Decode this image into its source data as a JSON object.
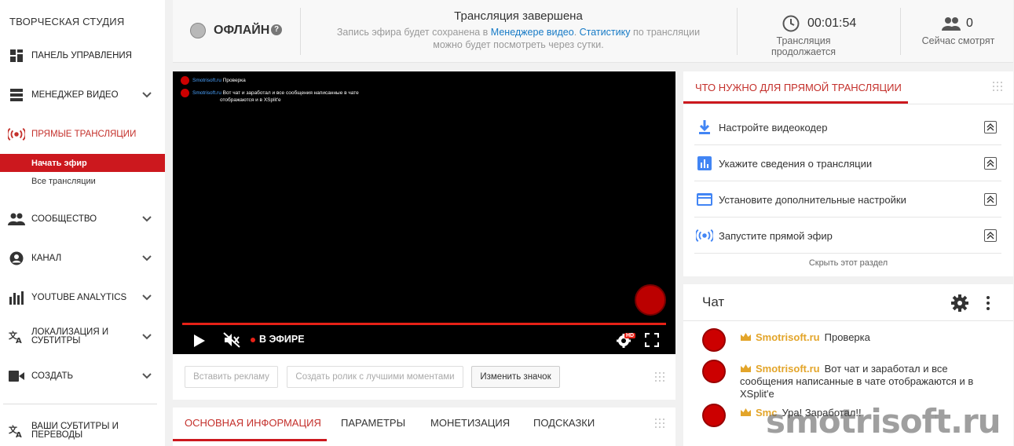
{
  "sidebar": {
    "title": "ТВОРЧЕСКАЯ СТУДИЯ",
    "items": [
      {
        "label": "ПАНЕЛЬ УПРАВЛЕНИЯ",
        "icon": "dashboard-icon"
      },
      {
        "label": "МЕНЕДЖЕР ВИДЕО",
        "icon": "video-manager-icon"
      },
      {
        "label": "ПРЯМЫЕ ТРАНСЛЯЦИИ",
        "icon": "live-icon"
      },
      {
        "label": "СООБЩЕСТВО",
        "icon": "community-icon"
      },
      {
        "label": "КАНАЛ",
        "icon": "channel-icon"
      },
      {
        "label": "YOUTUBE ANALYTICS",
        "icon": "analytics-icon"
      },
      {
        "label": "ЛОКАЛИЗАЦИЯ И\nСУБТИТРЫ",
        "label1": "ЛОКАЛИЗАЦИЯ И",
        "label2": "СУБТИТРЫ",
        "icon": "translate-icon"
      },
      {
        "label": "СОЗДАТЬ",
        "icon": "create-icon"
      },
      {
        "label1": "ВАШИ СУБТИТРЫ И",
        "label2": "ПЕРЕВОДЫ",
        "icon": "translate-icon"
      }
    ],
    "sub_items": [
      "Начать эфир",
      "Все трансляции"
    ]
  },
  "header": {
    "status": "ОФЛАЙН",
    "help": "?",
    "broadcast_title": "Трансляция завершена",
    "desc_part1": "Запись эфира будет сохранена в ",
    "desc_link1": "Менеджере видео",
    "desc_part2": ". ",
    "desc_link2": "Статистику",
    "desc_part3": " по трансляции",
    "desc_line2": "можно будет посмотреть через сутки.",
    "timer_value": "00:01:54",
    "timer_label": "Трансляция продолжается",
    "viewers_value": "0",
    "viewers_label": "Сейчас смотрят"
  },
  "player": {
    "overlay": [
      {
        "name": "Smotrisoft.ru",
        "text": "Проверка"
      },
      {
        "name": "Smotrisoft.ru",
        "text": "Вот чат и заработал и все сообщения написанные в чате",
        "text2": "отображаются и в XSplit'e"
      }
    ],
    "live_label": "В ЭФИРЕ",
    "hd": "HD"
  },
  "actions": {
    "ad": "Вставить рекламу",
    "highlights": "Создать ролик с лучшими моментами",
    "thumbnail": "Изменить значок"
  },
  "tabs": [
    "ОСНОВНАЯ ИНФОРМАЦИЯ",
    "ПАРАМЕТРЫ",
    "МОНЕТИЗАЦИЯ",
    "ПОДСКАЗКИ"
  ],
  "requirements": {
    "title": "ЧТО НУЖНО ДЛЯ ПРЯМОЙ ТРАНСЛЯЦИИ",
    "items": [
      {
        "label": "Настройте видеокодер",
        "icon": "download-icon"
      },
      {
        "label": "Укажите сведения о трансляции",
        "icon": "bar-chart-icon"
      },
      {
        "label": "Установите дополнительные настройки",
        "icon": "card-icon"
      },
      {
        "label": "Запустите прямой эфир",
        "icon": "broadcast-icon"
      }
    ],
    "hide": "Скрыть этот раздел"
  },
  "chat": {
    "title": "Чат",
    "messages": [
      {
        "author": "Smotrisoft.ru",
        "text": "Проверка"
      },
      {
        "author": "Smotrisoft.ru",
        "text": "Вот чат и заработал и все сообщения написанные в чате отображаются и в XSplit'e"
      },
      {
        "author": "Smc",
        "text": "Ура! Заработал!!"
      }
    ]
  },
  "watermark": "smotrisoft.ru",
  "colors": {
    "accent": "#cc181e",
    "link": "#167ac6",
    "author": "#e3a52a"
  }
}
